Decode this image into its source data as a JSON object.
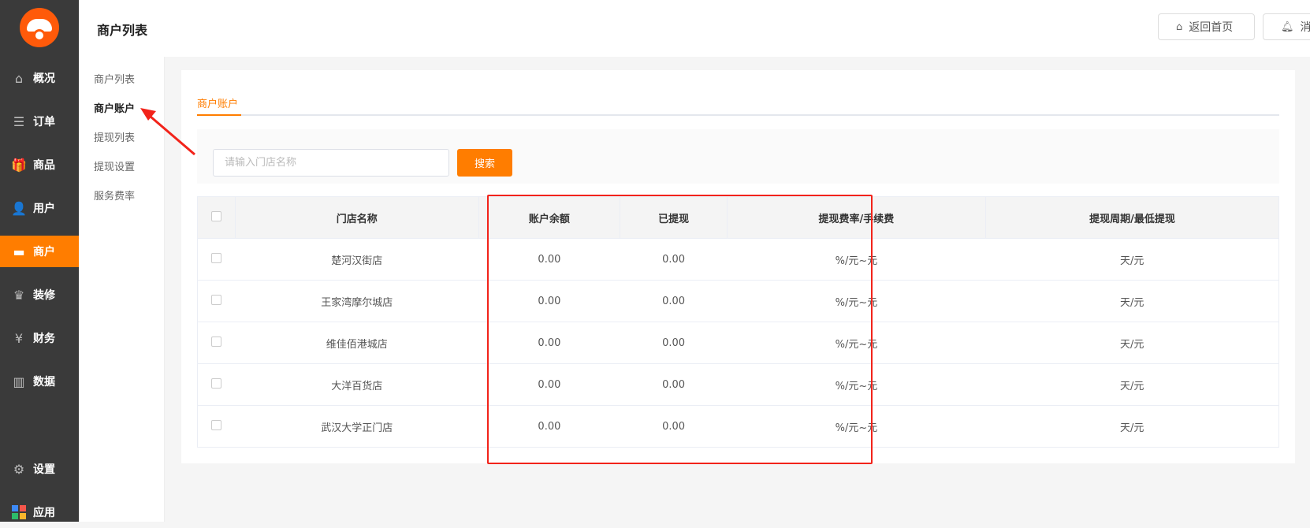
{
  "sidebar": {
    "items": [
      {
        "label": "概况",
        "icon": "home-icon",
        "glyph": "⌂"
      },
      {
        "label": "订单",
        "icon": "order-icon",
        "glyph": "☰"
      },
      {
        "label": "商品",
        "icon": "gift-icon",
        "glyph": "🎁"
      },
      {
        "label": "用户",
        "icon": "user-icon",
        "glyph": "👤"
      },
      {
        "label": "商户",
        "icon": "store-icon",
        "glyph": "▬"
      },
      {
        "label": "装修",
        "icon": "crown-icon",
        "glyph": "♛"
      },
      {
        "label": "财务",
        "icon": "finance-icon",
        "glyph": "¥"
      },
      {
        "label": "数据",
        "icon": "chart-icon",
        "glyph": "▥"
      },
      {
        "label": "设置",
        "icon": "gear-icon",
        "glyph": "⚙"
      },
      {
        "label": "应用",
        "icon": "apps-icon",
        "glyph": "■"
      }
    ],
    "active_index": 4
  },
  "header": {
    "title": "商户列表",
    "home_button": "返回首页",
    "message_button": "消息"
  },
  "submenu": {
    "items": [
      "商户列表",
      "商户账户",
      "提现列表",
      "提现设置",
      "服务费率"
    ],
    "active_index": 1
  },
  "main": {
    "tab": "商户账户",
    "search": {
      "placeholder": "请输入门店名称",
      "value": "",
      "button": "搜索"
    },
    "table": {
      "headers": [
        "门店名称",
        "账户余额",
        "已提现",
        "提现费率/手续费",
        "提现周期/最低提现"
      ],
      "rows": [
        [
          "楚河汉街店",
          "0.00",
          "0.00",
          "%/元~元",
          "天/元"
        ],
        [
          "王家湾摩尔城店",
          "0.00",
          "0.00",
          "%/元~元",
          "天/元"
        ],
        [
          "维佳佰港城店",
          "0.00",
          "0.00",
          "%/元~元",
          "天/元"
        ],
        [
          "大洋百货店",
          "0.00",
          "0.00",
          "%/元~元",
          "天/元"
        ],
        [
          "武汉大学正门店",
          "0.00",
          "0.00",
          "%/元~元",
          "天/元"
        ]
      ]
    }
  },
  "colors": {
    "accent": "#ff7d00",
    "sidebar": "#3a3a3a",
    "annotation": "#f2231a"
  }
}
